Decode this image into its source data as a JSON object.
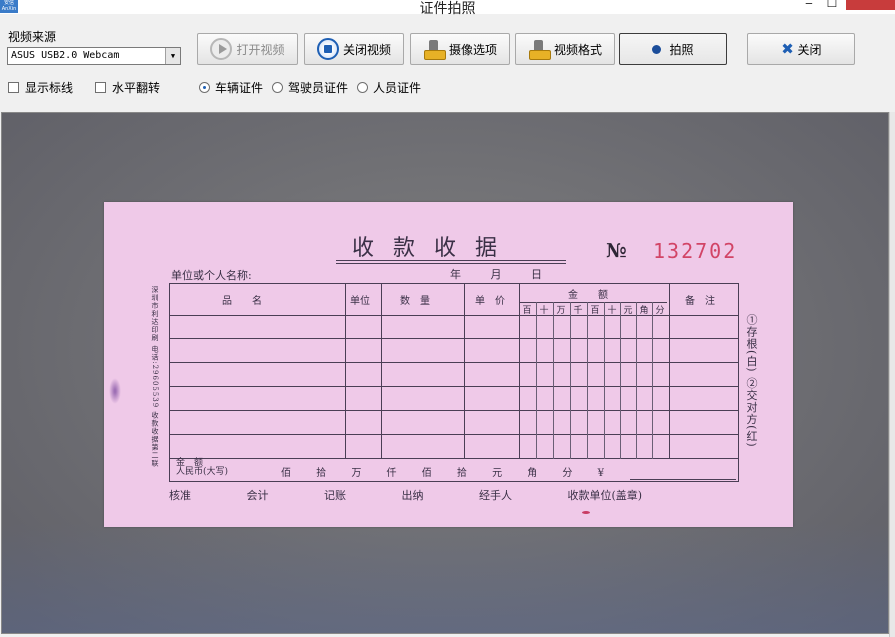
{
  "window": {
    "title": "证件拍照",
    "app_icon_text": "安信\nAnXin",
    "minimize_glyph": "‒",
    "maximize_glyph": "☐",
    "close_glyph": "✕"
  },
  "toolbar": {
    "source_label": "视频来源",
    "source_value": "ASUS USB2.0 Webcam",
    "source_arrow": "▼",
    "open_video_label": "打开视频",
    "close_video_label": "关闭视频",
    "camera_options_label": "摄像选项",
    "video_format_label": "视频格式",
    "capture_label": "拍照",
    "close_label": "关闭",
    "close_glyph": "✖",
    "icons": {
      "open_video": "play-icon",
      "close_video": "stop-icon",
      "camera_options": "camera-icon",
      "video_format": "camera-icon",
      "capture": "dot-icon",
      "close": "x-icon"
    }
  },
  "options": {
    "show_markers": {
      "label": "显示标线",
      "checked": false
    },
    "flip_horizontal": {
      "label": "水平翻转",
      "checked": false
    },
    "doc_types": [
      {
        "label": "车辆证件",
        "selected": true
      },
      {
        "label": "驾驶员证件",
        "selected": false
      },
      {
        "label": "人员证件",
        "selected": false
      }
    ]
  },
  "receipt": {
    "title": "收 款 收 据",
    "no_label": "№",
    "no_value": "132702",
    "unit_label": "单位或个人名称:",
    "date_label": "年 月 日",
    "left_vertical_text": "深圳市利达印刷 电话:29605539 收款收据第二联",
    "headers": {
      "name": "品　　名",
      "unit": "单位",
      "quantity": "数　量",
      "price": "单　价",
      "amount": "金　　额",
      "remarks": "备　注"
    },
    "digits": [
      "百",
      "十",
      "万",
      "千",
      "百",
      "十",
      "元",
      "角",
      "分"
    ],
    "total_label_line1": "金　额",
    "total_label_line2": "人民币",
    "total_label_suffix": "(大写)",
    "total_units": "佰 拾 万 仟 佰 拾 元 角 分 ¥",
    "right_vertical_text": "①存根(白) ②交对方(红)",
    "footer": "核准 会计 记账 出纳 经手人 收款单位(盖章)"
  }
}
